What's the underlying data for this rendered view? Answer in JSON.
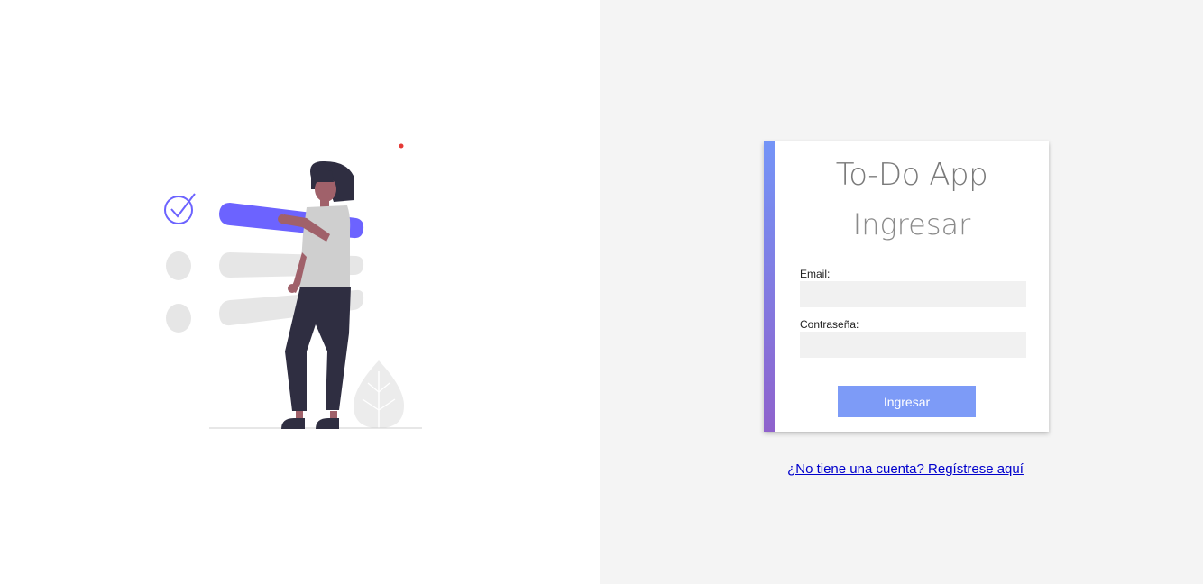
{
  "app": {
    "title": "To-Do App",
    "subtitle": "Ingresar"
  },
  "form": {
    "email_label": "Email:",
    "email_value": "",
    "password_label": "Contraseña:",
    "password_value": "",
    "submit_label": "Ingresar"
  },
  "footer": {
    "register_link": "¿No tiene una cuenta? Regístrese aquí"
  },
  "colors": {
    "accent_gradient_start": "#7494f7",
    "accent_gradient_end": "#8f62cc",
    "button": "#7d9bf7",
    "illustration_accent": "#6c63ff",
    "link": "#0000cc"
  },
  "illustration": {
    "icon": "todo-checklist-illustration"
  }
}
